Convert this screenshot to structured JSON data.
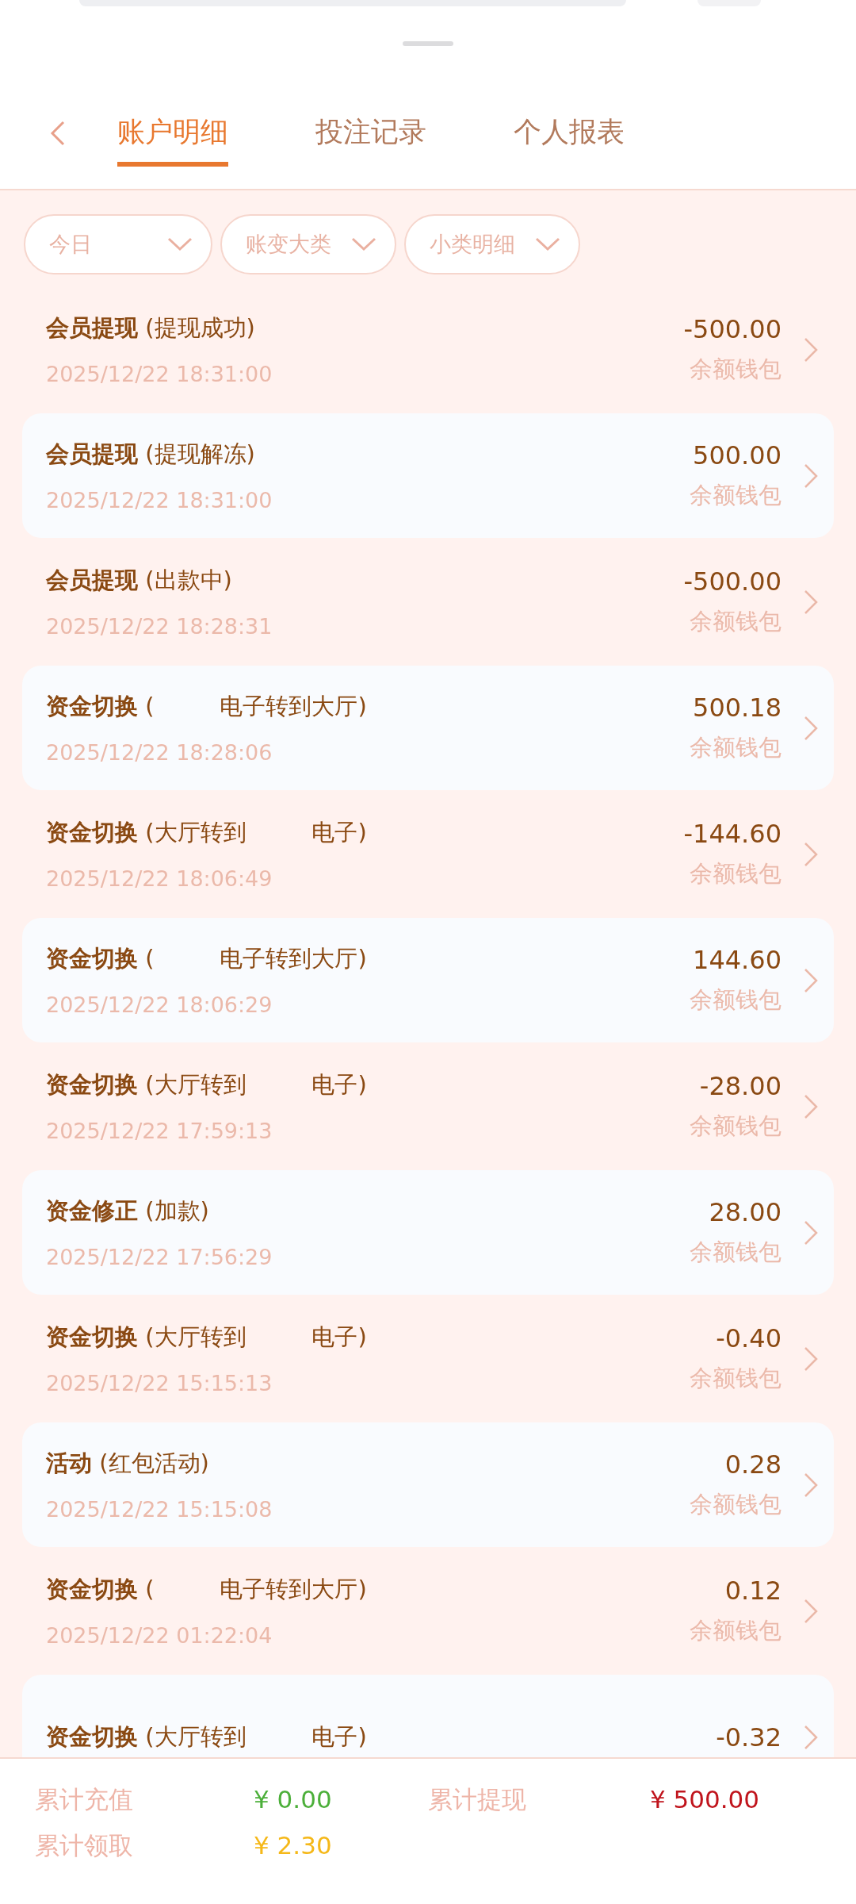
{
  "tabs": [
    {
      "label": "账户明细",
      "selected": true
    },
    {
      "label": "投注记录",
      "selected": false
    },
    {
      "label": "个人报表",
      "selected": false
    }
  ],
  "filters": [
    {
      "label": "今日"
    },
    {
      "label": "账变大类"
    },
    {
      "label": "小类明细"
    }
  ],
  "records": [
    {
      "title": "会员提现",
      "detail": "(提现成功)",
      "time": "2025/12/22 18:31:00",
      "amount": "-500.00",
      "wallet": "余额钱包"
    },
    {
      "title": "会员提现",
      "detail": "(提现解冻)",
      "time": "2025/12/22 18:31:00",
      "amount": "500.00",
      "wallet": "余额钱包"
    },
    {
      "title": "会员提现",
      "detail": "(出款中)",
      "time": "2025/12/22 18:28:31",
      "amount": "-500.00",
      "wallet": "余额钱包"
    },
    {
      "title": "资金切换",
      "detail": "(         电子转到大厅)",
      "time": "2025/12/22 18:28:06",
      "amount": "500.18",
      "wallet": "余额钱包"
    },
    {
      "title": "资金切换",
      "detail": "(大厅转到         电子)",
      "time": "2025/12/22 18:06:49",
      "amount": "-144.60",
      "wallet": "余额钱包"
    },
    {
      "title": "资金切换",
      "detail": "(         电子转到大厅)",
      "time": "2025/12/22 18:06:29",
      "amount": "144.60",
      "wallet": "余额钱包"
    },
    {
      "title": "资金切换",
      "detail": "(大厅转到         电子)",
      "time": "2025/12/22 17:59:13",
      "amount": "-28.00",
      "wallet": "余额钱包"
    },
    {
      "title": "资金修正",
      "detail": "(加款)",
      "time": "2025/12/22 17:56:29",
      "amount": "28.00",
      "wallet": "余额钱包"
    },
    {
      "title": "资金切换",
      "detail": "(大厅转到         电子)",
      "time": "2025/12/22 15:15:13",
      "amount": "-0.40",
      "wallet": "余额钱包"
    },
    {
      "title": "活动",
      "detail": "(红包活动)",
      "time": "2025/12/22 15:15:08",
      "amount": "0.28",
      "wallet": "余额钱包"
    },
    {
      "title": "资金切换",
      "detail": "(         电子转到大厅)",
      "time": "2025/12/22 01:22:04",
      "amount": "0.12",
      "wallet": "余额钱包"
    },
    {
      "title": "资金切换",
      "detail": "(大厅转到         电子)",
      "amount": "-0.32"
    }
  ],
  "summary": [
    {
      "label": "累计充值",
      "value": "¥ 0.00",
      "color": "#4caf3a"
    },
    {
      "label": "累计提现",
      "value": "¥ 500.00",
      "color": "#c0141c"
    },
    {
      "label": "累计领取",
      "value": "¥ 2.30",
      "color": "#f5b819"
    }
  ]
}
